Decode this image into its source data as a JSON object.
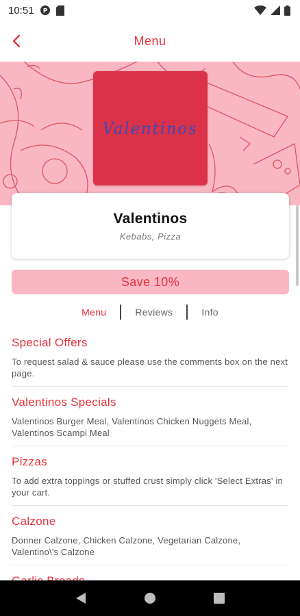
{
  "status_bar": {
    "time": "10:51"
  },
  "app_bar": {
    "title": "Menu"
  },
  "restaurant": {
    "logo_text": "Valentinos",
    "name": "Valentinos",
    "cuisine": "Kebabs, Pizza",
    "promo": "Save 10%"
  },
  "tabs": [
    {
      "label": "Menu",
      "active": true
    },
    {
      "label": "Reviews",
      "active": false
    },
    {
      "label": "Info",
      "active": false
    }
  ],
  "categories": [
    {
      "title": "Special Offers",
      "description": "To request salad & sauce please use the comments box on the next page."
    },
    {
      "title": "Valentinos Specials",
      "description": "Valentinos Burger Meal, Valentinos Chicken Nuggets Meal, Valentinos Scampi Meal"
    },
    {
      "title": "Pizzas",
      "description": "To add extra toppings or stuffed crust simply click 'Select Extras' in your cart."
    },
    {
      "title": "Calzone",
      "description": "Donner Calzone, Chicken Calzone, Vegetarian Calzone, Valentino\\'s Calzone"
    },
    {
      "title": "Garlic Breads",
      "description": ""
    }
  ],
  "colors": {
    "accent": "#e5333f",
    "hero_pink": "#f9b6c3",
    "logo_red": "#dc3249",
    "logo_text": "#3b4bb8"
  },
  "icons": {
    "back": "chevron-left-icon",
    "wifi": "wifi-icon",
    "signal": "signal-icon",
    "battery": "battery-icon"
  }
}
